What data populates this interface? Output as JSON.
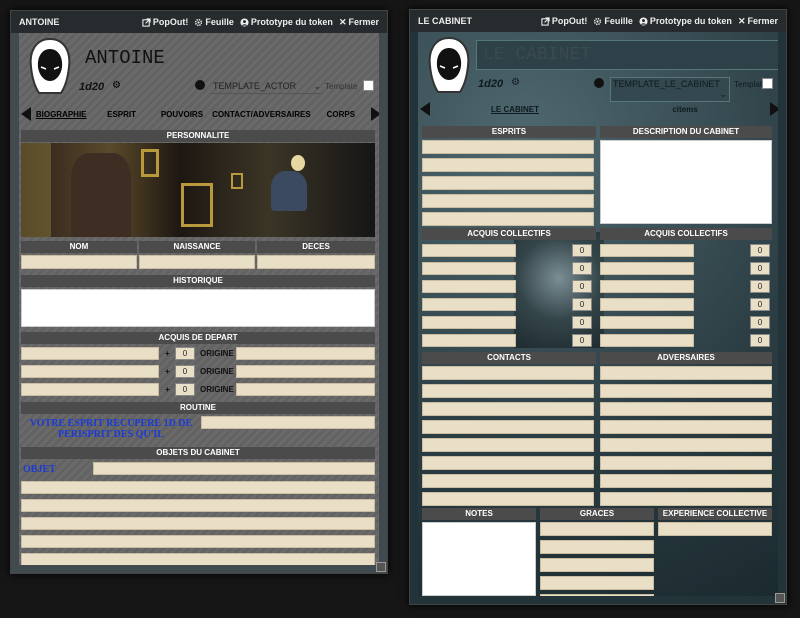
{
  "left": {
    "title": "ANTOINE",
    "buttons": {
      "popout": "PopOut!",
      "sheet": "Feuille",
      "token": "Prototype du token",
      "close": "Fermer"
    },
    "character_name": "ANTOINE",
    "dice": "1d20",
    "template_select": "TEMPLATE_ACTOR",
    "template_label": "Template",
    "tabs": [
      "BIOGRAPHIE",
      "ESPRIT",
      "POUVOIRS",
      "CONTACT/ADVERSAIRES",
      "CORPS"
    ],
    "section_personnalite": "PERSONNALITE",
    "col_nom": "NOM",
    "col_naissance": "NAISSANCE",
    "col_deces": "DECES",
    "section_historique": "HISTORIQUE",
    "section_acquis": "ACQUIS DE DEPART",
    "acquis_rows": [
      {
        "plus": "+",
        "value": "0",
        "label": "ORIGINE"
      },
      {
        "plus": "+",
        "value": "0",
        "label": "ORIGINE"
      },
      {
        "plus": "+",
        "value": "0",
        "label": "ORIGINE"
      }
    ],
    "section_routine": "ROUTINE",
    "routine_text": "VOTRE ESPRIT RECUPERE 1D DE PERISPRIT DES QU'IL",
    "section_objets": "OBJETS DU CABINET",
    "objet_label": "OBJET"
  },
  "right": {
    "title": "LE CABINET",
    "buttons": {
      "popout": "PopOut!",
      "sheet": "Feuille",
      "token": "Prototype du token",
      "close": "Fermer"
    },
    "cabinet_name": "LE CABINET",
    "dice": "1d20",
    "template_select": "TEMPLATE_LE_CABINET",
    "template_label": "Template",
    "tabs": [
      "LE CABINET",
      "citems"
    ],
    "section_esprits": "ESPRITS",
    "section_description": "DESCRIPTION DU CABINET",
    "section_acquis_1": "ACQUIS COLLECTIFS",
    "section_acquis_2": "ACQUIS COLLECTIFS",
    "acquis_values": [
      "0",
      "0",
      "0",
      "0",
      "0",
      "0"
    ],
    "section_contacts": "CONTACTS",
    "section_adversaires": "ADVERSAIRES",
    "section_notes": "NOTES",
    "section_graces": "GRACES",
    "section_experience": "EXPERIENCE COLLECTIVE"
  },
  "colors": {
    "field": "#e9dfc7",
    "header": "#4b4b4b",
    "link_blue": "#1b3ad6"
  }
}
